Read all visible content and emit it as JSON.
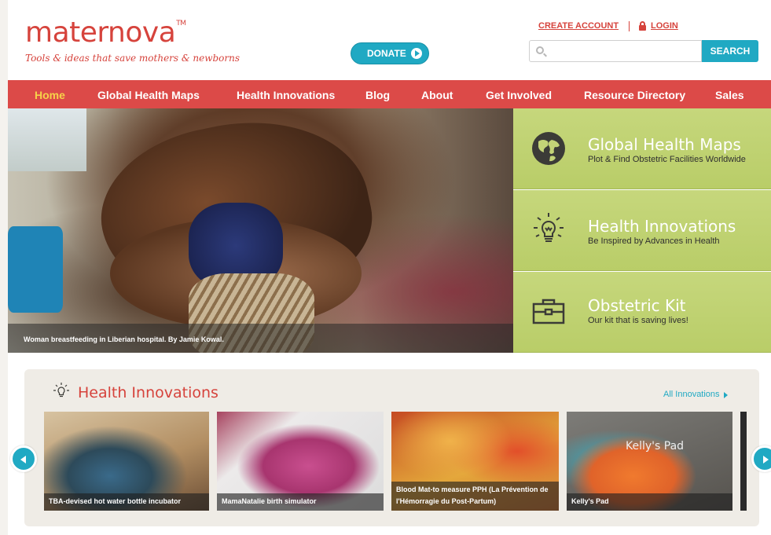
{
  "header": {
    "logo_text": "maternova",
    "logo_mark": "TM",
    "tagline": "Tools & ideas that save mothers & newborns",
    "donate_label": "DONATE",
    "create_account_label": "CREATE ACCOUNT",
    "login_label": "LOGIN",
    "search_placeholder": "",
    "search_button_label": "SEARCH"
  },
  "nav": {
    "items": [
      {
        "label": "Home"
      },
      {
        "label": "Global Health Maps"
      },
      {
        "label": "Health Innovations"
      },
      {
        "label": "Blog"
      },
      {
        "label": "About"
      },
      {
        "label": "Get Involved"
      },
      {
        "label": "Resource Directory"
      },
      {
        "label": "Sales"
      }
    ]
  },
  "hero": {
    "caption": "Woman breastfeeding in Liberian hospital. By Jamie Kowal."
  },
  "panels": [
    {
      "title": "Global Health Maps",
      "subtitle": "Plot & Find Obstetric Facilities Worldwide",
      "icon": "globe-icon"
    },
    {
      "title": "Health Innovations",
      "subtitle": "Be Inspired by Advances in Health",
      "icon": "lightbulb-icon"
    },
    {
      "title": "Obstetric Kit",
      "subtitle": "Our kit that is saving lives!",
      "icon": "toolbox-icon"
    }
  ],
  "innovations": {
    "title": "Health Innovations",
    "all_link": "All Innovations",
    "items": [
      {
        "label": "TBA-devised hot water bottle incubator"
      },
      {
        "label": "MamaNatalie birth simulator"
      },
      {
        "label": "Blood Mat-to measure PPH (La Prévention de l'Hémorragie du Post-Partum)"
      },
      {
        "label": "Kelly's Pad",
        "watermark": "Kelly's Pad"
      }
    ]
  },
  "colors": {
    "brand_red": "#d6433c",
    "nav_red": "#dc4a48",
    "accent_teal": "#20a9c3",
    "panel_green": "#c0d272",
    "nav_active": "#f6d24a"
  }
}
